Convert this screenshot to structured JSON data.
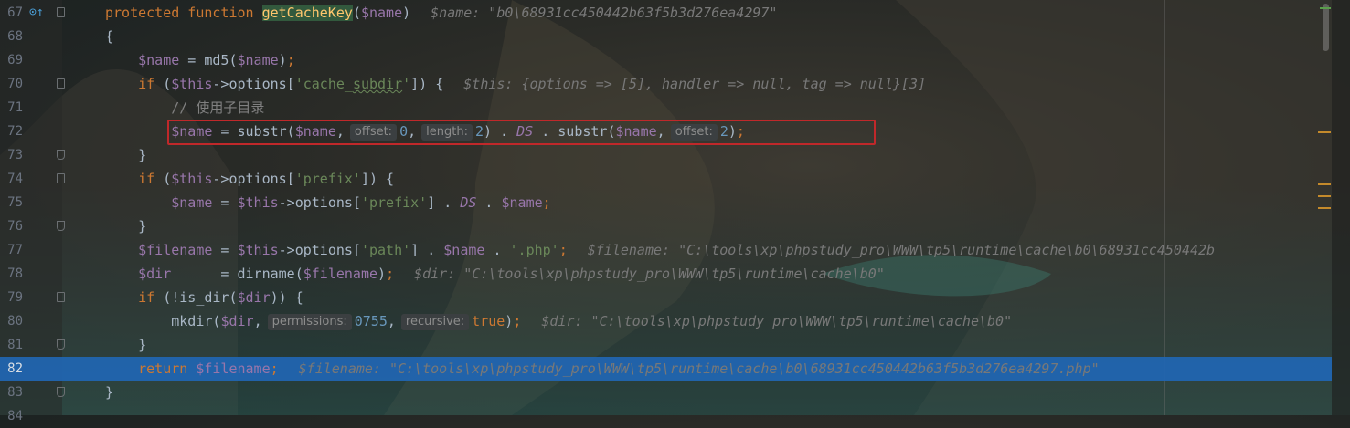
{
  "editor": {
    "current_line": "82",
    "lines": [
      {
        "num": "67",
        "parts": [
          [
            "kw",
            "protected function "
          ],
          [
            "fn-hl",
            "getCacheKey"
          ],
          [
            "plain",
            "("
          ],
          [
            "var",
            "$name"
          ],
          [
            "plain",
            ")"
          ]
        ],
        "debug": "$name: \"b0\\68931cc450442b63f5b3d276ea4297\""
      },
      {
        "num": "68",
        "parts": [
          [
            "plain",
            "{"
          ]
        ]
      },
      {
        "num": "69",
        "parts": [
          [
            "var",
            "    $name"
          ],
          [
            "plain",
            " = md5("
          ],
          [
            "var",
            "$name"
          ],
          [
            "plain",
            ")"
          ],
          [
            "kw",
            ";"
          ]
        ]
      },
      {
        "num": "70",
        "parts": [
          [
            "kw",
            "    if "
          ],
          [
            "plain",
            "("
          ],
          [
            "var",
            "$this"
          ],
          [
            "plain",
            "->options["
          ],
          [
            "str",
            "'cache_"
          ],
          [
            "str-squig",
            "subdir"
          ],
          [
            "str",
            "'"
          ],
          [
            "plain",
            "]) {"
          ]
        ],
        "debug": "$this: {options => [5], handler => null, tag => null}[3]"
      },
      {
        "num": "71",
        "parts": [
          [
            "cmt",
            "        // 使用子目录"
          ]
        ]
      },
      {
        "num": "72",
        "parts": [
          [
            "var",
            "        $name"
          ],
          [
            "plain",
            " = substr("
          ],
          [
            "var",
            "$name"
          ],
          [
            "plain",
            ","
          ],
          [
            "hint",
            "offset:"
          ],
          [
            "num",
            "0"
          ],
          [
            "plain",
            ","
          ],
          [
            "hint",
            "length:"
          ],
          [
            "num",
            "2"
          ],
          [
            "plain",
            ") . "
          ],
          [
            "const",
            "DS"
          ],
          [
            "plain",
            " . substr("
          ],
          [
            "var",
            "$name"
          ],
          [
            "plain",
            ","
          ],
          [
            "hint",
            "offset:"
          ],
          [
            "num",
            "2"
          ],
          [
            "plain",
            ")"
          ],
          [
            "kw",
            ";"
          ]
        ]
      },
      {
        "num": "73",
        "parts": [
          [
            "plain",
            "    }"
          ]
        ]
      },
      {
        "num": "74",
        "parts": [
          [
            "kw",
            "    if "
          ],
          [
            "plain",
            "("
          ],
          [
            "var",
            "$this"
          ],
          [
            "plain",
            "->options["
          ],
          [
            "str",
            "'prefix'"
          ],
          [
            "plain",
            "]) {"
          ]
        ]
      },
      {
        "num": "75",
        "parts": [
          [
            "var",
            "        $name"
          ],
          [
            "plain",
            " = "
          ],
          [
            "var",
            "$this"
          ],
          [
            "plain",
            "->options["
          ],
          [
            "str",
            "'prefix'"
          ],
          [
            "plain",
            "] . "
          ],
          [
            "const",
            "DS"
          ],
          [
            "plain",
            " . "
          ],
          [
            "var",
            "$name"
          ],
          [
            "kw",
            ";"
          ]
        ]
      },
      {
        "num": "76",
        "parts": [
          [
            "plain",
            "    }"
          ]
        ]
      },
      {
        "num": "77",
        "parts": [
          [
            "var",
            "    $filename"
          ],
          [
            "plain",
            " = "
          ],
          [
            "var",
            "$this"
          ],
          [
            "plain",
            "->options["
          ],
          [
            "str",
            "'path'"
          ],
          [
            "plain",
            "] . "
          ],
          [
            "var",
            "$name"
          ],
          [
            "plain",
            " . "
          ],
          [
            "str",
            "'.php'"
          ],
          [
            "kw",
            ";"
          ]
        ],
        "debug": "$filename: \"C:\\tools\\xp\\phpstudy_pro\\WWW\\tp5\\runtime\\cache\\b0\\68931cc450442b"
      },
      {
        "num": "78",
        "parts": [
          [
            "var",
            "    $dir"
          ],
          [
            "plain",
            "      = dirname("
          ],
          [
            "var",
            "$filename"
          ],
          [
            "plain",
            ")"
          ],
          [
            "kw",
            ";"
          ]
        ],
        "debug": "$dir: \"C:\\tools\\xp\\phpstudy_pro\\WWW\\tp5\\runtime\\cache\\b0\""
      },
      {
        "num": "79",
        "parts": [
          [
            "kw",
            "    if "
          ],
          [
            "plain",
            "(!is_dir("
          ],
          [
            "var",
            "$dir"
          ],
          [
            "plain",
            ")) {"
          ]
        ]
      },
      {
        "num": "80",
        "parts": [
          [
            "plain",
            "        mkdir("
          ],
          [
            "var",
            "$dir"
          ],
          [
            "plain",
            ","
          ],
          [
            "hint",
            "permissions:"
          ],
          [
            "num",
            "0755"
          ],
          [
            "plain",
            ","
          ],
          [
            "hint",
            "recursive:"
          ],
          [
            "kw",
            "true"
          ],
          [
            "plain",
            ")"
          ],
          [
            "kw",
            ";"
          ]
        ],
        "debug": "$dir: \"C:\\tools\\xp\\phpstudy_pro\\WWW\\tp5\\runtime\\cache\\b0\""
      },
      {
        "num": "81",
        "parts": [
          [
            "plain",
            "    }"
          ]
        ]
      },
      {
        "num": "82",
        "parts": [
          [
            "kw",
            "    return "
          ],
          [
            "var",
            "$filename"
          ],
          [
            "kw",
            ";"
          ]
        ],
        "debug": "$filename: \"C:\\tools\\xp\\phpstudy_pro\\WWW\\tp5\\runtime\\cache\\b0\\68931cc450442b63f5b3d276ea4297.php\""
      },
      {
        "num": "83",
        "parts": [
          [
            "plain",
            "}"
          ]
        ]
      },
      {
        "num": "84",
        "parts": []
      }
    ]
  },
  "colors": {
    "current_line_bg": "#2166b3",
    "highlight_box": "#c0282a",
    "keyword": "#cc7832",
    "variable": "#9876aa",
    "string": "#6a8759"
  },
  "icons": {
    "breakpoint": "method-override-icon"
  }
}
